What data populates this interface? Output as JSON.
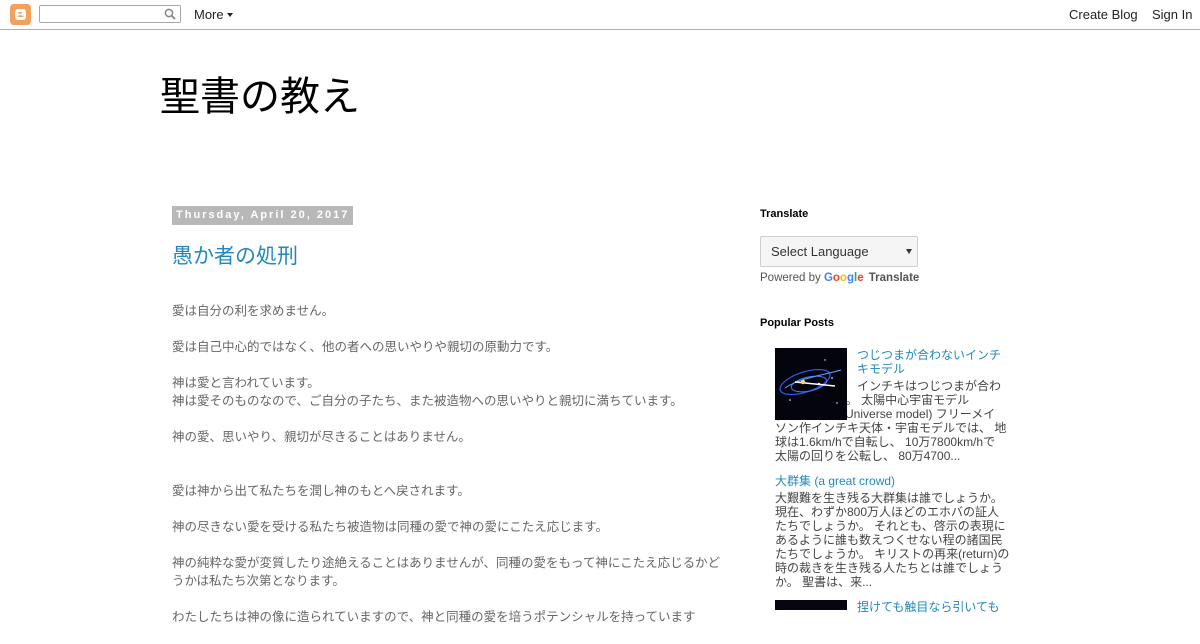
{
  "navbar": {
    "logo_icon": "blogger-logo-icon",
    "search_placeholder": "",
    "more_label": "More",
    "create_blog_label": "Create Blog",
    "sign_in_label": "Sign In"
  },
  "blog": {
    "title": "聖書の教え"
  },
  "post": {
    "date": "Thursday, April 20, 2017",
    "title": "愚か者の処刑",
    "paragraphs": [
      "愛は自分の利を求めません。",
      "愛は自己中心的ではなく、他の者への思いやりや親切の原動力です。",
      "神は愛と言われています。",
      "神は愛そのものなので、ご自分の子たち、また被造物への思いやりと親切に満ちています。",
      "神の愛、思いやり、親切が尽きることはありません。",
      "愛は神から出て私たちを潤し神のもとへ戻されます。",
      "神の尽きない愛を受ける私たち被造物は同種の愛で神の愛にこたえ応じます。",
      "神の純粋な愛が変質したり途絶えることはありませんが、同種の愛をもって神にこたえ応じるかどうかは私たち次第となります。",
      "わたしたちは神の像に造られていますので、神と同種の愛を培うポテンシャルを持っています"
    ]
  },
  "sidebar": {
    "translate": {
      "title": "Translate",
      "select_label": "Select Language",
      "powered_by": "Powered by",
      "google": "Google",
      "translate_link": "Translate"
    },
    "popular": {
      "title": "Popular Posts",
      "items": [
        {
          "title": "つじつまが合わないインチキモデル",
          "snippet": "インチキはつじつまが合わなくなります。 太陽中心宇宙モデル (Heliocentric Universe model) フリーメイソン作インチキ天体・宇宙モデルでは、 地球は1.6km/hで自転し、 10万7800km/hで太陽の回りを公転し、 80万4700..."
        },
        {
          "title": "大群集 (a great crowd)",
          "snippet": "大艱難を生き残る大群集は誰でしょうか。 現在、わずか800万人ほどのエホバの証人たちでしょうか。 それとも、啓示の表現にあるように誰も数えつくせない程の諸国民たちでしょうか。 キリストの再来(return)の時の裁きを生き残る人たちとは誰でしょうか。 聖書は、来..."
        },
        {
          "title": "捏けても触目なら引いても"
        }
      ]
    }
  },
  "colors": {
    "link": "#2288bb",
    "date_bg": "#b8b8b8",
    "body_text": "#666666",
    "blogger_orange": "#f4a15d"
  }
}
